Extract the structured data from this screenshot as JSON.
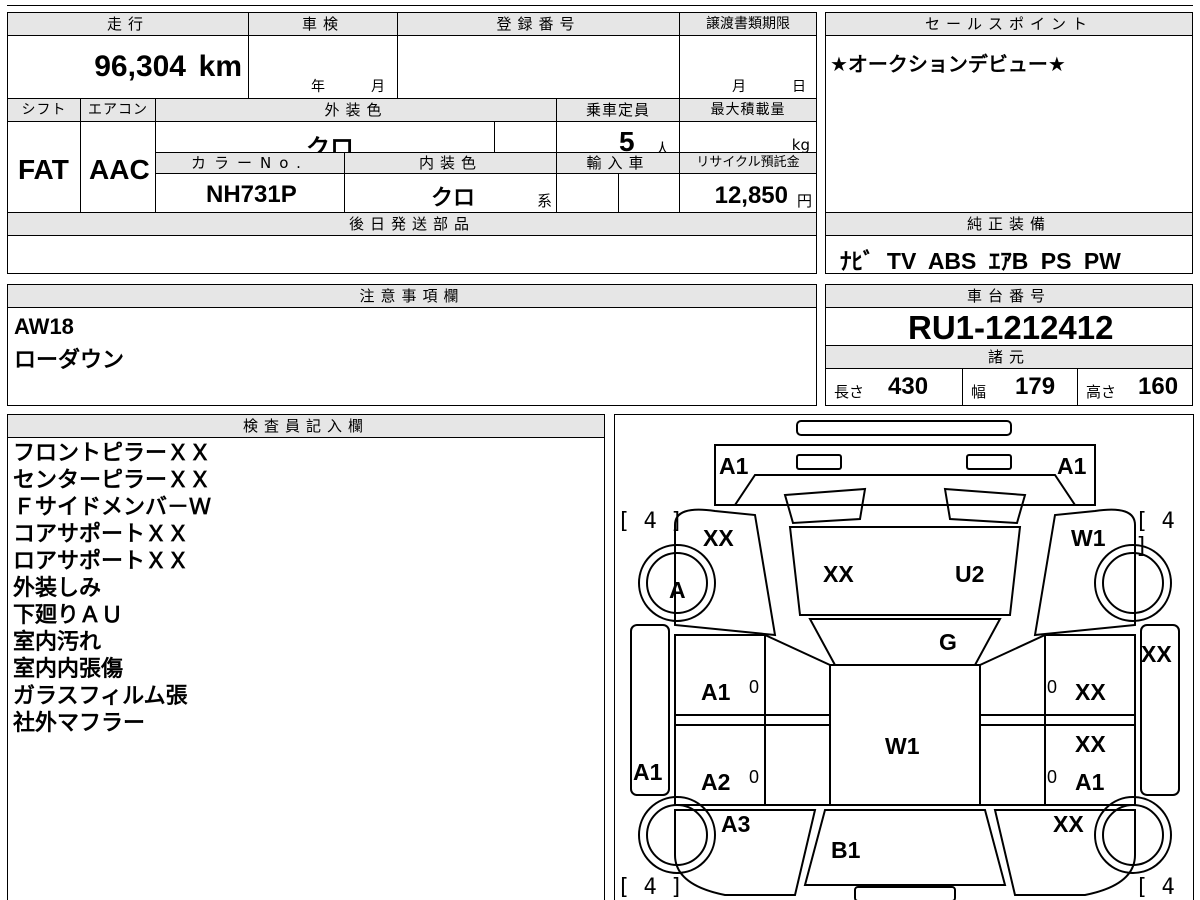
{
  "top_table": {
    "headers": {
      "mileage": "走行",
      "inspection": "車検",
      "reg_number": "登録番号",
      "transfer_deadline": "譲渡書類期限",
      "shift": "シフト",
      "aircon": "エアコン",
      "exterior_color": "外装色",
      "capacity": "乗車定員",
      "max_load": "最大積載量",
      "color_no": "カラーNo.",
      "interior_color": "内装色",
      "import": "輸入車",
      "recycle_fee": "リサイクル預託金",
      "later_parts": "後日発送部品"
    },
    "values": {
      "mileage": "96,304",
      "mileage_unit": "km",
      "year_label": "年",
      "month_label": "月",
      "deadline_month": "月",
      "deadline_day": "日",
      "shift": "FAT",
      "aircon": "AAC",
      "exterior_color": "クロ",
      "capacity": "5",
      "capacity_unit": "人",
      "max_load_unit": "kg",
      "color_no": "NH731P",
      "interior_color": "クロ",
      "interior_suffix": "系",
      "recycle_fee": "12,850",
      "recycle_unit": "円"
    }
  },
  "sales_point": {
    "header": "セールスポイント",
    "text": "★オークションデビュー★"
  },
  "genuine_equipment": {
    "header": "純正装備",
    "text": "ﾅﾋﾞ TV ABS ｴｱB PS PW"
  },
  "caution": {
    "header": "注意事項欄",
    "lines": [
      "AW18",
      "ローダウン"
    ]
  },
  "chassis": {
    "header": "車台番号",
    "number": "RU1-1212412",
    "specs_header": "諸元",
    "length_label": "長さ",
    "length": "430",
    "width_label": "幅",
    "width": "179",
    "height_label": "高さ",
    "height": "160"
  },
  "inspector": {
    "header": "検査員記入欄",
    "lines": [
      "フロントピラーＸＸ",
      "センターピラーＸＸ",
      "Ｆサイドメンバ－Ｗ",
      "コアサポートＸＸ",
      "ロアサポートＸＸ",
      "外装しみ",
      "下廻りＡＵ",
      "室内汚れ",
      "室内内張傷",
      "ガラスフィルム張",
      "社外マフラー"
    ]
  },
  "diagram": {
    "marks": {
      "a1_front_left": "A1",
      "a1_front_right": "A1",
      "xx_fender_left": "XX",
      "w1_fender_right": "W1",
      "xx_hood_left": "XX",
      "u2_hood_right": "U2",
      "a_wheel": "A",
      "g_windshield": "G",
      "xx_side_right": "XX",
      "a1_front_door_left": "A1",
      "xx_front_door_right": "XX",
      "w1_roof": "W1",
      "xx_rear_door_right_top": "XX",
      "a1_rocker_left": "A1",
      "a2_rear_door_left": "A2",
      "a1_rear_door_right": "A1",
      "a3_rear_left": "A3",
      "xx_rear_right": "XX",
      "b1_rear": "B1",
      "zero_1": "0",
      "zero_2": "0",
      "zero_3": "0",
      "zero_4": "0"
    },
    "tires": {
      "front_left": "[ 4 ]",
      "front_right": "[ 4 ]",
      "rear_left": "[ 4 ]",
      "rear_right": "[ 4 ]"
    }
  }
}
